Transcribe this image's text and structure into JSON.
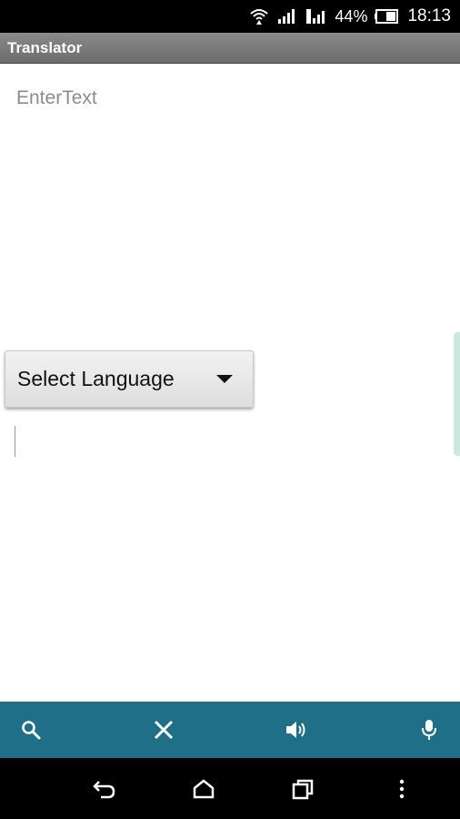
{
  "status_bar": {
    "battery": "44%",
    "time": "18:13",
    "icons": [
      "wifi-icon",
      "signal-icon",
      "signal-2-icon",
      "battery-icon"
    ]
  },
  "app": {
    "title": "Translator"
  },
  "input": {
    "placeholder": "EnterText",
    "value": ""
  },
  "language_spinner": {
    "selected": "Select Language"
  },
  "output": {
    "value": ""
  },
  "toolbar": {
    "buttons": [
      "search-icon",
      "close-icon",
      "speaker-icon",
      "microphone-icon"
    ]
  },
  "navigation": {
    "buttons": [
      "back-icon",
      "home-icon",
      "recents-icon",
      "overflow-icon"
    ]
  },
  "colors": {
    "toolbar_bg": "#1f6f88",
    "titlebar_bg": "#7a7a7a"
  }
}
